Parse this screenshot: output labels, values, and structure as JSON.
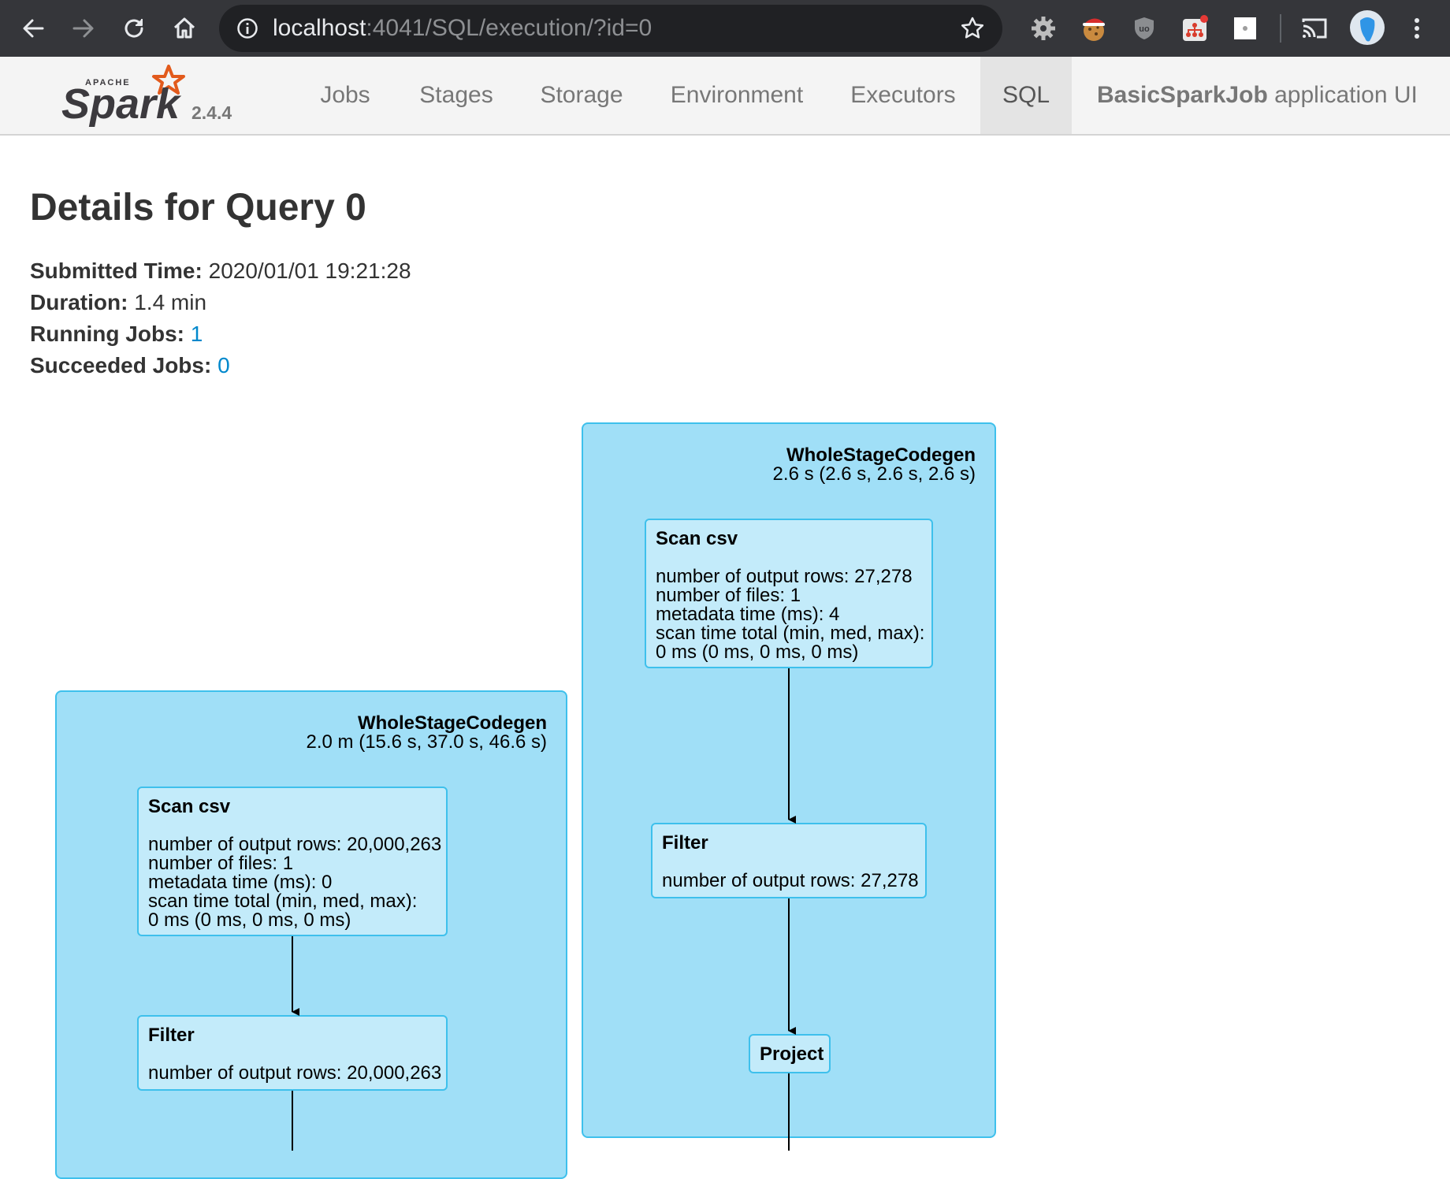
{
  "browser": {
    "url_host": "localhost",
    "url_rest": ":4041/SQL/execution/?id=0",
    "icons": [
      "back-arrow-icon",
      "forward-arrow-icon",
      "reload-icon",
      "home-icon",
      "site-info-icon",
      "bookmark-star-icon",
      "gear-extension-icon",
      "cookie-extension-icon",
      "ublock-shield-icon",
      "network-extension-icon",
      "extension-square-icon",
      "cast-icon",
      "profile-avatar-icon",
      "more-menu-icon"
    ]
  },
  "navbar": {
    "brand_version": "2.4.4",
    "tabs": [
      {
        "label": "Jobs"
      },
      {
        "label": "Stages"
      },
      {
        "label": "Storage"
      },
      {
        "label": "Environment"
      },
      {
        "label": "Executors"
      },
      {
        "label": "SQL",
        "active": true
      }
    ],
    "app_name": "BasicSparkJob",
    "app_suffix": " application UI"
  },
  "page": {
    "title": "Details for Query 0",
    "submitted_label": "Submitted Time:",
    "submitted_value": " 2020/01/01 19:21:28",
    "duration_label": "Duration:",
    "duration_value": " 1.4 min",
    "running_label": "Running Jobs:",
    "running_value": "1",
    "succeeded_label": "Succeeded Jobs:",
    "succeeded_value": "0"
  },
  "plan": {
    "left_cluster": {
      "name": "WholeStageCodegen",
      "time": "2.0 m (15.6 s, 37.0 s, 46.6 s)",
      "scan": {
        "name": "Scan csv",
        "metrics": [
          "number of output rows: 20,000,263",
          "number of files: 1",
          "metadata time (ms): 0",
          "scan time total (min, med, max):",
          "0 ms (0 ms, 0 ms, 0 ms)"
        ]
      },
      "filter": {
        "name": "Filter",
        "metrics": [
          "number of output rows: 20,000,263"
        ]
      }
    },
    "right_cluster": {
      "name": "WholeStageCodegen",
      "time": "2.6 s (2.6 s, 2.6 s, 2.6 s)",
      "scan": {
        "name": "Scan csv",
        "metrics": [
          "number of output rows: 27,278",
          "number of files: 1",
          "metadata time (ms): 4",
          "scan time total (min, med, max):",
          "0 ms (0 ms, 0 ms, 0 ms)"
        ]
      },
      "filter": {
        "name": "Filter",
        "metrics": [
          "number of output rows: 27,278"
        ]
      },
      "project": {
        "name": "Project"
      }
    }
  },
  "colors": {
    "cluster_fill": "#a0dff7",
    "node_fill": "#c3ebfa",
    "node_border": "#3ec0ec",
    "link": "#0088cc",
    "spark_orange": "#e25a1c"
  }
}
